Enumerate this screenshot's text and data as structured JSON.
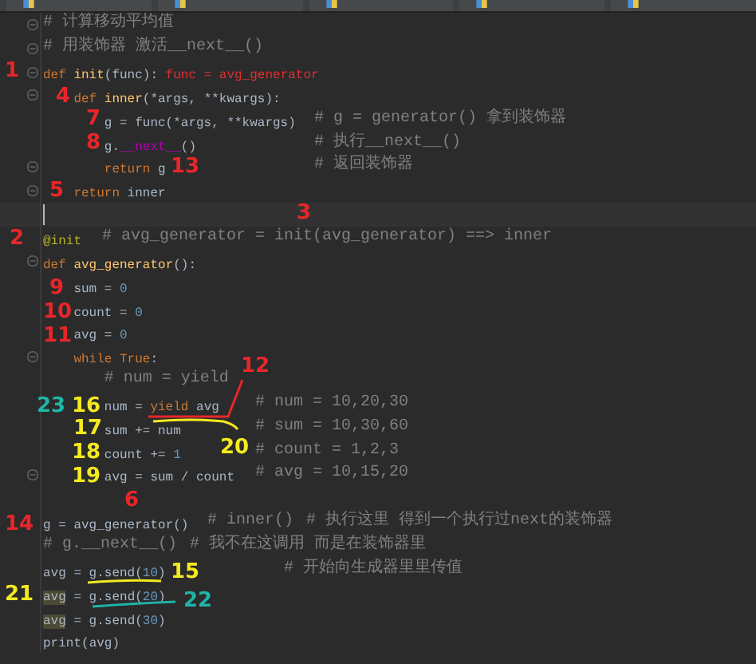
{
  "lines": [
    {
      "comments": [
        "# 计算移动平均值"
      ],
      "fold": true
    },
    {
      "comments": [
        "# 用装饰器 激活__next__()"
      ],
      "fold": true
    },
    {
      "code": [
        {
          "text": "def ",
          "kind": "kw"
        },
        {
          "text": "init",
          "kind": "fn"
        },
        {
          "text": "(func): ",
          "kind": "plain"
        },
        {
          "text": "func = avg_generator",
          "kind": "red"
        }
      ],
      "fold": true,
      "children": [
        {
          "code": [
            {
              "text": "def ",
              "kind": "kw"
            },
            {
              "text": "inner",
              "kind": "fn"
            },
            {
              "text": "(*args, **kwargs):",
              "kind": "plain"
            }
          ],
          "fold": true,
          "children": [
            {
              "code": [
                {
                  "text": "g = func(*args, **kwargs)",
                  "kind": "plain"
                }
              ],
              "comments": [
                "# g = generator() 拿到装饰器"
              ]
            },
            {
              "code": [
                {
                  "text": "g.",
                  "kind": "plain"
                },
                {
                  "text": "__next__",
                  "kind": "magic"
                },
                {
                  "text": "()",
                  "kind": "plain"
                }
              ],
              "comments": [
                "# 执行__next__()"
              ]
            },
            {
              "code": [
                {
                  "text": "return ",
                  "kind": "kw"
                },
                {
                  "text": "g",
                  "kind": "plain"
                }
              ],
              "comments": [
                "# 返回装饰器"
              ],
              "fold": true
            }
          ]
        },
        {
          "code": [
            {
              "text": "return ",
              "kind": "kw"
            },
            {
              "text": "inner",
              "kind": "plain"
            }
          ],
          "fold": true
        }
      ]
    },
    {
      "current": true
    },
    {
      "code": [
        {
          "text": "@init",
          "kind": "deco"
        }
      ],
      "comments": [
        "# avg_generator = init(avg_generator) ==> inner"
      ]
    },
    {
      "code": [
        {
          "text": "def ",
          "kind": "kw"
        },
        {
          "text": "avg_generator",
          "kind": "fn"
        },
        {
          "text": "():",
          "kind": "plain"
        }
      ],
      "fold": true,
      "children": [
        {
          "code": [
            {
              "text": "sum = ",
              "kind": "plain"
            },
            {
              "text": "0",
              "kind": "num"
            }
          ]
        },
        {
          "code": [
            {
              "text": "count = ",
              "kind": "plain"
            },
            {
              "text": "0",
              "kind": "num"
            }
          ]
        },
        {
          "code": [
            {
              "text": "avg = ",
              "kind": "plain"
            },
            {
              "text": "0",
              "kind": "num"
            }
          ]
        },
        {
          "code": [
            {
              "text": "while ",
              "kind": "kw"
            },
            {
              "text": "True",
              "kind": "kw"
            },
            {
              "text": ":",
              "kind": "plain"
            }
          ],
          "fold": true,
          "children": [
            {
              "comments": [
                "# num = yield"
              ]
            },
            {
              "code": [
                {
                  "text": "num = ",
                  "kind": "plain"
                },
                {
                  "text": "yield ",
                  "kind": "kw"
                },
                {
                  "text": "avg",
                  "kind": "plain"
                }
              ],
              "comments": [
                "# num = 10,20,30"
              ]
            },
            {
              "code": [
                {
                  "text": "sum += num",
                  "kind": "plain"
                }
              ],
              "comments": [
                "# sum = 10,30,60"
              ]
            },
            {
              "code": [
                {
                  "text": "count += ",
                  "kind": "plain"
                },
                {
                  "text": "1",
                  "kind": "num"
                }
              ],
              "comments": [
                "# count = 1,2,3"
              ]
            },
            {
              "code": [
                {
                  "text": "avg = sum / count",
                  "kind": "plain"
                }
              ],
              "comments": [
                "# avg = 10,15,20"
              ],
              "fold": true
            }
          ]
        }
      ]
    },
    {
      "current": false
    },
    {
      "code": [
        {
          "text": "g = avg_generator() ",
          "kind": "plain"
        }
      ],
      "comments": [
        "# inner()",
        "# 执行这里 得到一个执行过next的装饰器"
      ]
    },
    {
      "comments": [
        "# g.__next__()",
        "# 我不在这调用 而是在装饰器里"
      ]
    },
    {
      "code": [
        {
          "text": "avg = g.send(",
          "kind": "plain"
        },
        {
          "text": "10",
          "kind": "num"
        },
        {
          "text": ")",
          "kind": "plain"
        }
      ],
      "comments": [
        "# 开始向生成器里里传值"
      ]
    },
    {
      "code": [
        {
          "text": "avg",
          "kind": "hl"
        },
        {
          "text": " = g.send(",
          "kind": "plain"
        },
        {
          "text": "20",
          "kind": "num"
        },
        {
          "text": ")",
          "kind": "plain"
        }
      ]
    },
    {
      "code": [
        {
          "text": "avg",
          "kind": "hl"
        },
        {
          "text": " = g.send(",
          "kind": "plain"
        },
        {
          "text": "30",
          "kind": "num"
        },
        {
          "text": ")",
          "kind": "plain"
        }
      ]
    },
    {
      "code": [
        {
          "text": "print",
          "kind": "plain"
        },
        {
          "text": "(avg)",
          "kind": "plain"
        }
      ]
    }
  ],
  "annotations": [
    {
      "text": "1",
      "color": "#e8262a"
    },
    {
      "text": "4",
      "color": "#e8262a"
    },
    {
      "text": "7",
      "color": "#e8262a"
    },
    {
      "text": "8",
      "color": "#e8262a"
    },
    {
      "text": "13",
      "color": "#e8262a"
    },
    {
      "text": "5",
      "color": "#e8262a"
    },
    {
      "text": "3",
      "color": "#e8262a"
    },
    {
      "text": "2",
      "color": "#e8262a"
    },
    {
      "text": "9",
      "color": "#e8262a"
    },
    {
      "text": "10",
      "color": "#e8262a"
    },
    {
      "text": "11",
      "color": "#e8262a"
    },
    {
      "text": "12",
      "color": "#e8262a"
    },
    {
      "text": "23",
      "color": "#1fb5a8"
    },
    {
      "text": "16",
      "color": "#f4ea20"
    },
    {
      "text": "17",
      "color": "#f4ea20"
    },
    {
      "text": "18",
      "color": "#f4ea20"
    },
    {
      "text": "19",
      "color": "#f4ea20"
    },
    {
      "text": "20",
      "color": "#f4ea20"
    },
    {
      "text": "6",
      "color": "#e8262a"
    },
    {
      "text": "14",
      "color": "#e8262a"
    },
    {
      "text": "15",
      "color": "#f4ea20"
    },
    {
      "text": "21",
      "color": "#f4ea20"
    },
    {
      "text": "22",
      "color": "#1fb5a8"
    }
  ]
}
